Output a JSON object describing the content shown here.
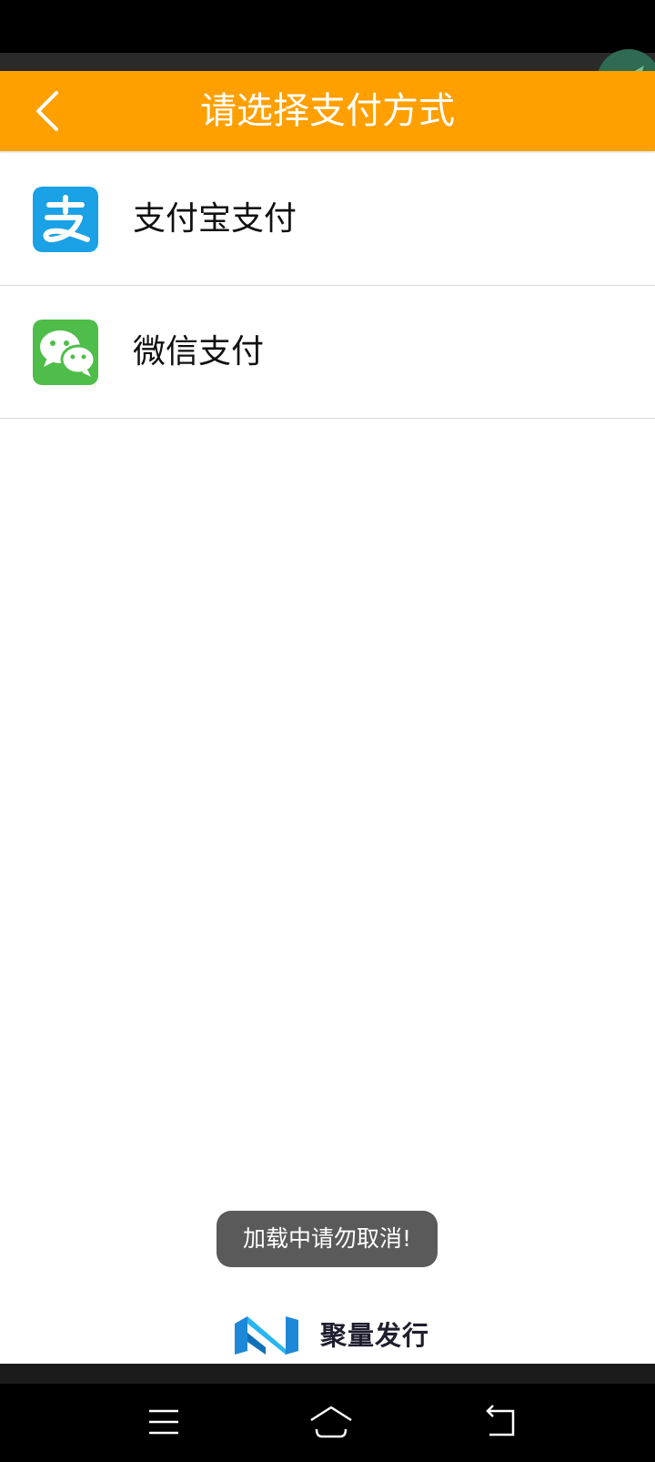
{
  "header": {
    "title": "请选择支付方式"
  },
  "payment_methods": [
    {
      "label": "支付宝支付",
      "icon": "alipay-icon",
      "color": "#1aa1e6"
    },
    {
      "label": "微信支付",
      "icon": "wechat-icon",
      "color": "#4fbd4a"
    }
  ],
  "toast": {
    "text": "加载中请勿取消!"
  },
  "brand": {
    "name": "聚量发行"
  },
  "nav": {
    "buttons": [
      "menu-icon",
      "home-icon",
      "back-icon"
    ]
  },
  "colors": {
    "header": "#ffa000",
    "toast_bg": "#5a5a5a"
  }
}
